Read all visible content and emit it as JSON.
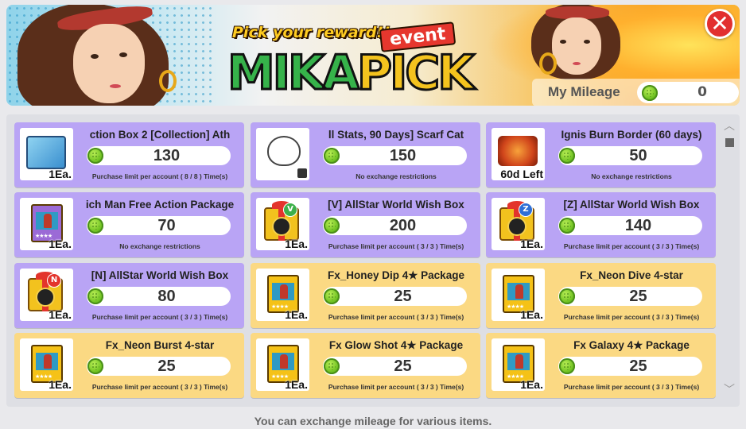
{
  "banner": {
    "subtitle": "Pick your reward!!",
    "event_tag": "event",
    "title_a": "MIKA",
    "title_b": "PICK",
    "close_label": "✕"
  },
  "mileage": {
    "label": "My Mileage",
    "value": "0"
  },
  "items": [
    {
      "name": "ction Box 2    [Collection] Ath",
      "price": "130",
      "qty": "1Ea.",
      "limit": "Purchase limit per account ( 8 / 8 ) Time(s)",
      "icon": "collection-box-icon",
      "theme": "purple"
    },
    {
      "name": "ll Stats, 90 Days] Scarf Cat",
      "price": "150",
      "qty": "",
      "limit": "No exchange restrictions",
      "icon": "scarf-cat-icon",
      "theme": "purple"
    },
    {
      "name": "Ignis Burn Border (60 days)",
      "price": "50",
      "qty": "60d Left",
      "limit": "No exchange restrictions",
      "icon": "burn-border-icon",
      "theme": "purple"
    },
    {
      "name": "ich Man Free Action Package",
      "price": "70",
      "qty": "1Ea.",
      "limit": "No exchange restrictions",
      "icon": "action-package-icon",
      "theme": "purple"
    },
    {
      "name": "[V] AllStar World Wish Box",
      "price": "200",
      "qty": "1Ea.",
      "limit": "Purchase limit per account ( 3 / 3 ) Time(s)",
      "icon": "wish-box-v-icon",
      "theme": "purple",
      "letter": "V",
      "letter_color": "#3db04a"
    },
    {
      "name": "[Z] AllStar World Wish Box",
      "price": "140",
      "qty": "1Ea.",
      "limit": "Purchase limit per account ( 3 / 3 ) Time(s)",
      "icon": "wish-box-z-icon",
      "theme": "purple",
      "letter": "Z",
      "letter_color": "#2f6fd6"
    },
    {
      "name": "[N] AllStar World Wish Box",
      "price": "80",
      "qty": "1Ea.",
      "limit": "Purchase limit per account ( 3 / 3 ) Time(s)",
      "icon": "wish-box-n-icon",
      "theme": "purple",
      "letter": "N",
      "letter_color": "#e3342c"
    },
    {
      "name": "Fx_Honey Dip 4★ Package",
      "price": "25",
      "qty": "1Ea.",
      "limit": "Purchase limit per account ( 3 / 3 ) Time(s)",
      "icon": "fx-package-icon",
      "theme": "yellow"
    },
    {
      "name": "Fx_Neon Dive 4-star",
      "price": "25",
      "qty": "1Ea.",
      "limit": "Purchase limit per account ( 3 / 3 ) Time(s)",
      "icon": "fx-package-icon",
      "theme": "yellow"
    },
    {
      "name": "Fx_Neon Burst 4-star",
      "price": "25",
      "qty": "1Ea.",
      "limit": "Purchase limit per account ( 3 / 3 ) Time(s)",
      "icon": "fx-package-icon",
      "theme": "yellow"
    },
    {
      "name": "Fx Glow Shot 4★ Package",
      "price": "25",
      "qty": "1Ea.",
      "limit": "Purchase limit per account ( 3 / 3 ) Time(s)",
      "icon": "fx-package-icon",
      "theme": "yellow"
    },
    {
      "name": "Fx Galaxy 4★ Package",
      "price": "25",
      "qty": "1Ea.",
      "limit": "Purchase limit per account ( 3 / 3 ) Time(s)",
      "icon": "fx-package-icon",
      "theme": "yellow"
    }
  ],
  "footer": {
    "text": "You can exchange mileage for various items."
  },
  "scroll": {
    "up": "︿",
    "down": "﹀"
  }
}
